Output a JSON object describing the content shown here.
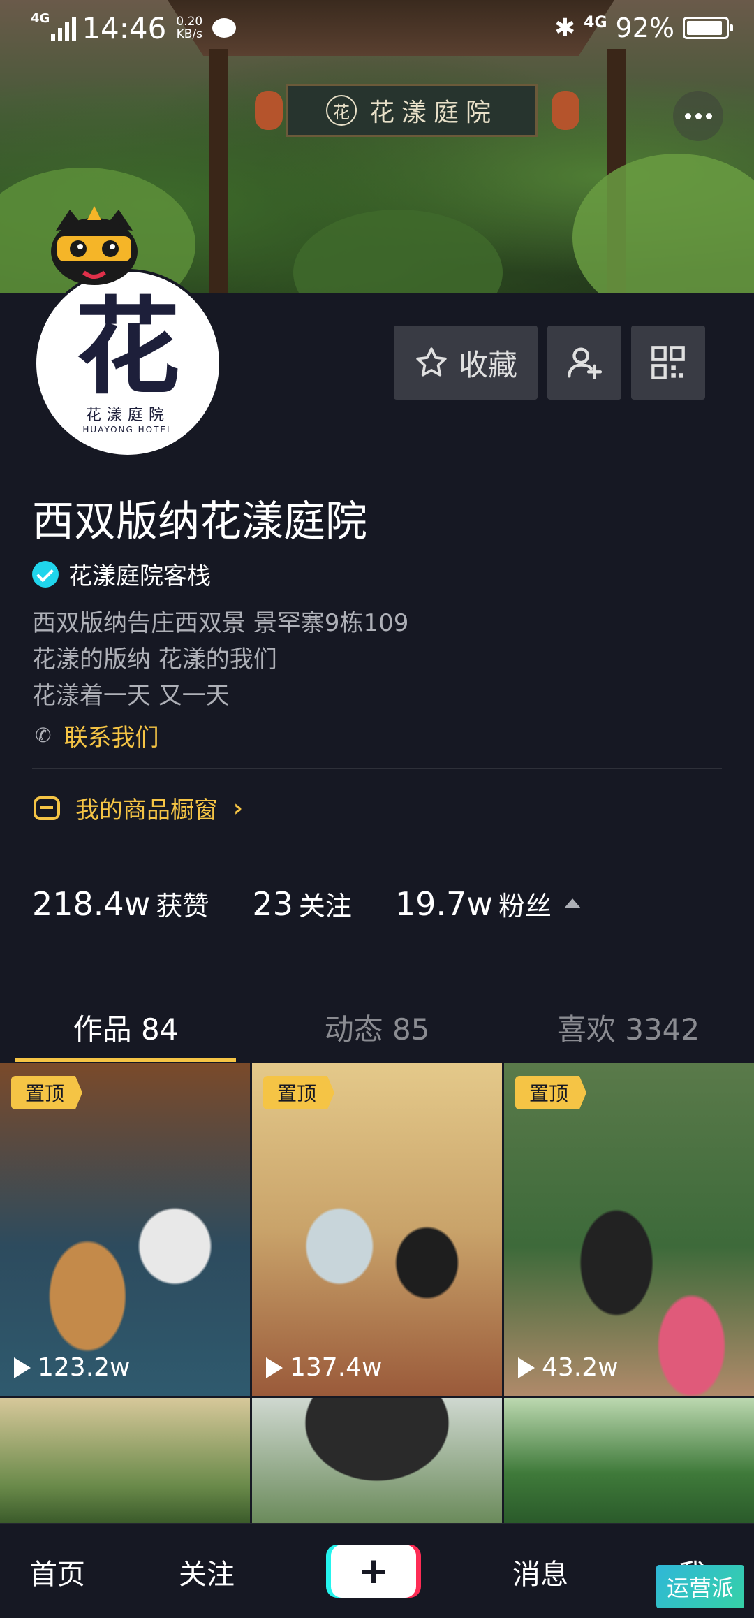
{
  "status_bar": {
    "network": "4G",
    "time": "14:46",
    "speed_value": "0.20",
    "speed_unit": "KB/s",
    "network_right": "4G",
    "battery_text": "92%",
    "battery_level": 0.92
  },
  "cover": {
    "sign_seal": "花",
    "sign_text": "花漾庭院"
  },
  "profile": {
    "avatar_glyph": "花",
    "avatar_name": "花漾庭院",
    "avatar_en": "HUAYONG HOTEL",
    "name": "西双版纳花漾庭院",
    "verified_label": "花漾庭院客栈",
    "bio_lines": [
      "西双版纳告庄西双景 景罕寨9栋109",
      "花漾的版纳 花漾的我们",
      "花漾着一天 又一天"
    ],
    "contact_label": "联系我们",
    "shop_label": "我的商品橱窗"
  },
  "actions": {
    "favorite_label": "收藏"
  },
  "stats": {
    "likes_value": "218.4w",
    "likes_label": "获赞",
    "following_value": "23",
    "following_label": "关注",
    "followers_value": "19.7w",
    "followers_label": "粉丝"
  },
  "tabs": [
    {
      "label": "作品 84"
    },
    {
      "label": "动态 85"
    },
    {
      "label": "喜欢 3342"
    }
  ],
  "videos": [
    {
      "pinned": "置顶",
      "plays": "123.2w"
    },
    {
      "pinned": "置顶",
      "plays": "137.4w"
    },
    {
      "pinned": "置顶",
      "plays": "43.2w"
    }
  ],
  "nav": {
    "home": "首页",
    "follow": "关注",
    "create": "+",
    "messages": "消息",
    "me": "我"
  },
  "watermark": "运营派",
  "colors": {
    "background": "#161823",
    "accent": "#f5c445",
    "verified": "#20d5ec",
    "secondary_text": "#aeb0b7"
  }
}
